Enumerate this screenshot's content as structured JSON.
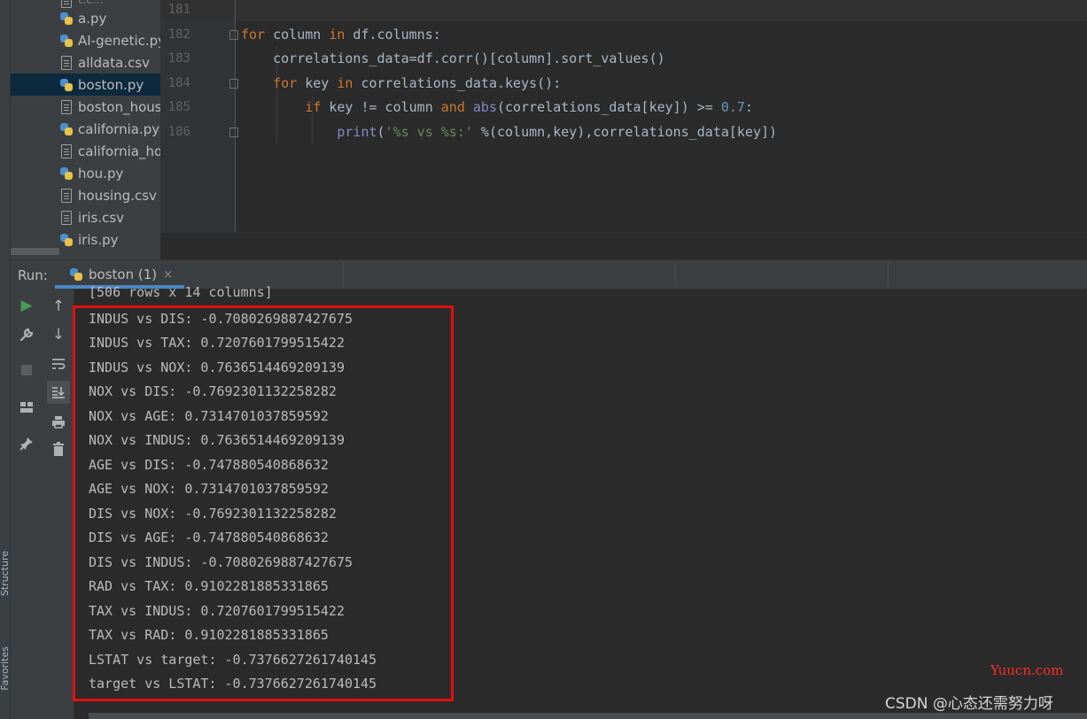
{
  "sidebar": {
    "structure_label": "Structure",
    "favorites_label": "Favorites"
  },
  "project_tree": {
    "cutoff_top": "t.c...",
    "items": [
      {
        "name": "a.py",
        "type": "python"
      },
      {
        "name": "AI-genetic.py",
        "type": "python"
      },
      {
        "name": "alldata.csv",
        "type": "text"
      },
      {
        "name": "boston.py",
        "type": "python",
        "selected": true
      },
      {
        "name": "boston_housing.csv",
        "type": "text"
      },
      {
        "name": "california.py",
        "type": "python"
      },
      {
        "name": "california_housing.csv",
        "type": "text"
      },
      {
        "name": "hou.py",
        "type": "python"
      },
      {
        "name": "housing.csv",
        "type": "text"
      },
      {
        "name": "iris.csv",
        "type": "text"
      },
      {
        "name": "iris.py",
        "type": "python"
      }
    ]
  },
  "editor": {
    "line_numbers": [
      "181",
      "182",
      "183",
      "184",
      "185",
      "186"
    ],
    "code": {
      "line182": {
        "kw1": "for",
        "t1": " column ",
        "kw2": "in",
        "t2": " df.columns:"
      },
      "line183": {
        "t1": "    correlations_data=df.corr()[column].sort_values()"
      },
      "line184": {
        "kw1": "    for",
        "t1": " key ",
        "kw2": "in",
        "t2": " correlations_data.keys():"
      },
      "line185": {
        "kw1": "        if",
        "t1": " key != column ",
        "kw2": "and",
        "t2": " ",
        "bi": "abs",
        "t3": "(correlations_data[key]) >= ",
        "num": "0.7",
        "t4": ":"
      },
      "line186": {
        "bi": "            print",
        "t1": "(",
        "str": "'%s vs %s:'",
        "t2": " %(column,key),correlations_data[key])"
      }
    }
  },
  "run_panel": {
    "label": "Run:",
    "tab_title": "boston (1)",
    "tab_close": "×"
  },
  "console": {
    "header_line": "[506 rows x 14 columns]",
    "lines": [
      "INDUS vs DIS: -0.7080269887427675",
      "INDUS vs TAX: 0.7207601799515422",
      "INDUS vs NOX: 0.7636514469209139",
      "NOX vs DIS: -0.7692301132258282",
      "NOX vs AGE: 0.7314701037859592",
      "NOX vs INDUS: 0.7636514469209139",
      "AGE vs DIS: -0.747880540868632",
      "AGE vs NOX: 0.7314701037859592",
      "DIS vs NOX: -0.7692301132258282",
      "DIS vs AGE: -0.747880540868632",
      "DIS vs INDUS: -0.7080269887427675",
      "RAD vs TAX: 0.9102281885331865",
      "TAX vs INDUS: 0.7207601799515422",
      "TAX vs RAD: 0.9102281885331865",
      "LSTAT vs target: -0.7376627261740145",
      "target vs LSTAT: -0.7376627261740145"
    ]
  },
  "watermarks": {
    "yuucn": "Yuucn.com",
    "csdn": "CSDN @心态还需努力呀"
  },
  "colors": {
    "highlight_box": "#e01010",
    "keyword": "#cc7832",
    "builtin": "#8888c6",
    "number": "#6897bb",
    "string": "#6a8759"
  }
}
